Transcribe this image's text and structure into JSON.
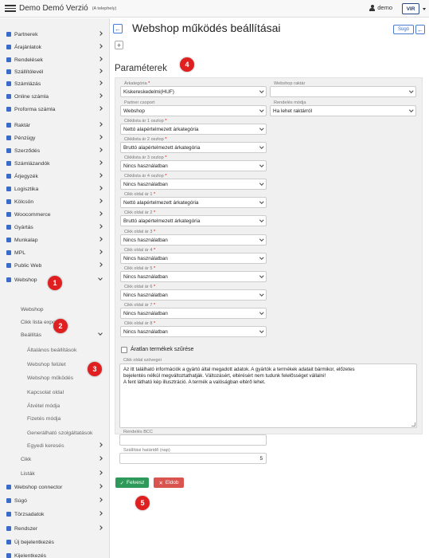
{
  "header": {
    "title": "Demo Demó Verzió",
    "subtitle": "(A telephely)",
    "user": "demo",
    "logo_text": "VIR"
  },
  "sidebar": {
    "items": [
      {
        "label": "Partnerek",
        "icon": "partner-icon",
        "color": "#3a6bc8"
      },
      {
        "label": "Árajánlatok",
        "icon": "offer-icon",
        "color": "#3a6bc8"
      },
      {
        "label": "Rendelések",
        "icon": "order-icon",
        "color": "#3a6bc8"
      },
      {
        "label": "Szállítólevél",
        "icon": "delivery-icon",
        "color": "#3a6bc8"
      },
      {
        "label": "Számlázás",
        "icon": "invoice-icon",
        "color": "#3a6bc8"
      },
      {
        "label": "Online számla",
        "icon": "globe-icon",
        "color": "#3a6bc8"
      },
      {
        "label": "Proforma számla",
        "icon": "proforma-icon",
        "color": "#3a6bc8"
      },
      {
        "label": "Raktár",
        "icon": "warehouse-icon",
        "color": "#3a6bc8"
      },
      {
        "label": "Pénzügy",
        "icon": "money-icon",
        "color": "#3a6bc8"
      },
      {
        "label": "Szerződés",
        "icon": "contract-icon",
        "color": "#3a6bc8"
      },
      {
        "label": "Számlázandók",
        "icon": "tobill-icon",
        "color": "#3a6bc8"
      },
      {
        "label": "Árjegyzék",
        "icon": "pricelist-icon",
        "color": "#3a6bc8"
      },
      {
        "label": "Logisztika",
        "icon": "logistics-icon",
        "color": "#3a6bc8"
      },
      {
        "label": "Kölcsön",
        "icon": "loan-icon",
        "color": "#3a6bc8"
      },
      {
        "label": "Woocommerce",
        "icon": "woocommerce-icon",
        "color": "#3a6bc8"
      },
      {
        "label": "Gyártás",
        "icon": "production-icon",
        "color": "#3a6bc8"
      },
      {
        "label": "Munkalap",
        "icon": "worksheet-icon",
        "color": "#3a6bc8"
      },
      {
        "label": "MPL",
        "icon": "mpl-icon",
        "color": "#3a6bc8"
      },
      {
        "label": "Public Web",
        "icon": "publicweb-icon",
        "color": "#3a6bc8"
      },
      {
        "label": "Webshop",
        "icon": "cart-icon",
        "color": "#3a6bc8"
      }
    ],
    "webshop_sub": [
      "Webshop",
      "Cikk lista export",
      "Beállítás"
    ],
    "settings_sub": [
      "Általános beállítások",
      "Webshop felület",
      "Webshop működés",
      "Kapcsolat oldal",
      "Átvétel módja",
      "Fizetés módja",
      "Generálható szolgáltatások",
      "Egyedi keresés"
    ],
    "webshop_sub_tail": [
      "Cikk",
      "Listák"
    ],
    "bottom_items": [
      {
        "label": "Webshop connector",
        "icon": "cart-icon"
      },
      {
        "label": "Súgó",
        "icon": "help-icon"
      },
      {
        "label": "Törzsadatok",
        "icon": "master-data-icon"
      },
      {
        "label": "Rendszer",
        "icon": "system-icon"
      },
      {
        "label": "Új bejelentkezés",
        "icon": "login-icon"
      },
      {
        "label": "Kijelentkezés",
        "icon": "logout-icon"
      }
    ]
  },
  "main": {
    "title": "Webshop működés beállításai",
    "help_label": "Súgó",
    "section_title": "Paraméterek",
    "fields": {
      "arkategoria": {
        "label": "Árkategória",
        "value": "Kiskereskedelmi(HUF)"
      },
      "webshop_raktar": {
        "label": "Webshop raktár",
        "value": ""
      },
      "partner_csoport": {
        "label": "Partner csoport",
        "value": "Webshop"
      },
      "rendeles_modja": {
        "label": "Rendelés módja",
        "value": "Ha lehet raktárról"
      },
      "cikklista_1": {
        "label": "Cikklista ár 1 oszlop",
        "value": "Nettó alapértelmezett árkategória"
      },
      "cikklista_2": {
        "label": "Cikklista ár 2 oszlop",
        "value": "Bruttó alapértelmezett árkategória"
      },
      "cikklista_3": {
        "label": "Cikklista ár 3 oszlop",
        "value": "Nincs használatban"
      },
      "cikklista_4": {
        "label": "Cikklista ár 4 oszlop",
        "value": "Nincs használatban"
      },
      "cikk_oldal_1": {
        "label": "Cikk oldal ár 1",
        "value": "Nettó alapértelmezett árkategória"
      },
      "cikk_oldal_2": {
        "label": "Cikk oldal ár 2",
        "value": "Bruttó alapértelmezett árkategória"
      },
      "cikk_oldal_3": {
        "label": "Cikk oldal ár 3",
        "value": "Nincs használatban"
      },
      "cikk_oldal_4": {
        "label": "Cikk oldal ár 4",
        "value": "Nincs használatban"
      },
      "cikk_oldal_5": {
        "label": "Cikk oldal ár 5",
        "value": "Nincs használatban"
      },
      "cikk_oldal_6": {
        "label": "Cikk oldal ár 6",
        "value": "Nincs használatban"
      },
      "cikk_oldal_7": {
        "label": "Cikk oldal ár 7",
        "value": "Nincs használatban"
      },
      "cikk_oldal_8": {
        "label": "Cikk oldal ár 8",
        "value": "Nincs használatban"
      },
      "rendeles_bcc": {
        "label": "Rendelés BCC",
        "value": ""
      },
      "szallitasi_hatarido": {
        "label": "Szállítási határidő (nap)",
        "value": "5"
      }
    },
    "checkbox_label": "Áratlan termékek szűrése",
    "textarea_label": "Cikk oldal szövegei",
    "textarea_lines": [
      "Az itt található információk a gyártó által megadott adatok. A gyártók a termékek adatait bármikor, előzetes",
      "bejelentés nélkül megváltoztathatják. Változásért, eltérésért nem tudunk felelősséget vállalni!",
      "A fent látható kép illusztráció. A termék a valóságban eltérő lehet."
    ],
    "save_label": "Felvesz",
    "cancel_label": "Eldob"
  },
  "markers": [
    "1",
    "2",
    "3",
    "4",
    "5"
  ],
  "colors": {
    "accent": "#3a6bc8",
    "save": "#2e9a5a",
    "cancel": "#d9534f",
    "marker": "#e02020"
  }
}
